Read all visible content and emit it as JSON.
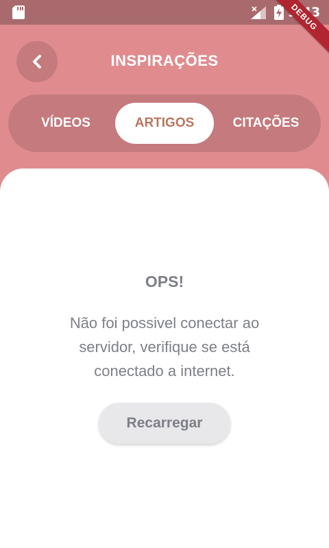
{
  "status_bar": {
    "time": "9:43",
    "debug_label": "DEBUG",
    "icons": [
      "sd-card-icon",
      "signal-icon",
      "battery-charging-icon"
    ]
  },
  "header": {
    "title": "INSPIRAÇÕES",
    "back_icon": "chevron-left-icon"
  },
  "tabs": [
    {
      "label": "VÍDEOS",
      "active": false
    },
    {
      "label": "ARTIGOS",
      "active": true
    },
    {
      "label": "CITAÇÕES",
      "active": false
    }
  ],
  "error": {
    "title": "OPS!",
    "message": "Não foi possivel conectar ao servidor, verifique se está conectado a internet.",
    "reload_label": "Recarregar"
  },
  "colors": {
    "background": "#e08c8f",
    "status_bar": "#a86a6d",
    "tab_container": "#c57a7d",
    "active_tab_text": "#b9755f",
    "text_gray": "#7d7f87",
    "debug_ribbon": "#b0252f"
  }
}
